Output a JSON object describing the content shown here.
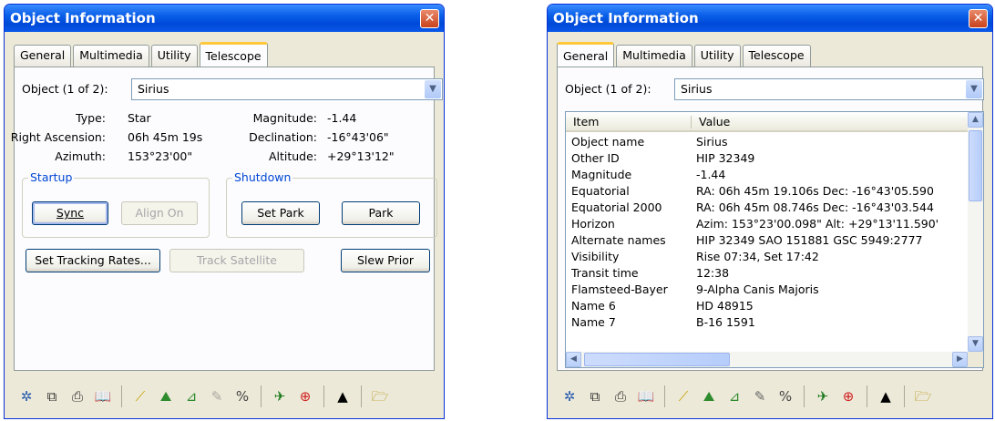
{
  "left_window": {
    "title": "Object Information",
    "close_glyph": "✕",
    "tabs": [
      {
        "label": "General"
      },
      {
        "label": "Multimedia"
      },
      {
        "label": "Utility"
      },
      {
        "label": "Telescope",
        "active": true
      }
    ],
    "object_label": "Object (1 of 2):",
    "object_value": "Sirius",
    "type_label": "Type:",
    "type_value": "Star",
    "ra_label": "Right Ascension:",
    "ra_value": "06h 45m 19s",
    "azimuth_label": "Azimuth:",
    "azimuth_value": "153°23'00\"",
    "magnitude_label": "Magnitude:",
    "magnitude_value": "-1.44",
    "declination_label": "Declination:",
    "declination_value": "-16°43'06\"",
    "altitude_label": "Altitude:",
    "altitude_value": "+29°13'12\"",
    "startup_title": "Startup",
    "shutdown_title": "Shutdown",
    "sync_label": "Sync",
    "align_on_label": "Align On",
    "set_park_label": "Set Park",
    "park_label": "Park",
    "set_tracking_rates_label": "Set Tracking Rates...",
    "track_satellite_label": "Track Satellite",
    "slew_prior_label": "Slew Prior"
  },
  "right_window": {
    "title": "Object Information",
    "close_glyph": "✕",
    "tabs": [
      {
        "label": "General",
        "active": true
      },
      {
        "label": "Multimedia"
      },
      {
        "label": "Utility"
      },
      {
        "label": "Telescope"
      }
    ],
    "object_label": "Object (1 of 2):",
    "object_value": "Sirius",
    "columns": [
      "Item",
      "Value"
    ],
    "rows": [
      {
        "item": "Object name",
        "value": "Sirius"
      },
      {
        "item": "Other ID",
        "value": "HIP 32349"
      },
      {
        "item": "Magnitude",
        "value": "-1.44"
      },
      {
        "item": "Equatorial",
        "value": "RA: 06h 45m 19.106s  Dec: -16°43'05.590"
      },
      {
        "item": "Equatorial 2000",
        "value": "RA: 06h 45m 08.746s  Dec: -16°43'03.544"
      },
      {
        "item": "Horizon",
        "value": "Azim: 153°23'00.098\"  Alt: +29°13'11.590'"
      },
      {
        "item": "Alternate names",
        "value": "HIP 32349 SAO 151881 GSC 5949:2777"
      },
      {
        "item": "Visibility",
        "value": "Rise 07:34, Set 17:42"
      },
      {
        "item": "Transit time",
        "value": "12:38"
      },
      {
        "item": "Flamsteed-Bayer",
        "value": "9-Alpha Canis Majoris"
      },
      {
        "item": "Name 6",
        "value": "HD 48915"
      },
      {
        "item": "Name 7",
        "value": "B-16 1591"
      }
    ]
  },
  "toolbar_icons": [
    {
      "name": "sparkle-icon",
      "glyph": "✲",
      "color": "#2a5db0"
    },
    {
      "name": "copy-icon",
      "glyph": "⧉",
      "color": "#333333"
    },
    {
      "name": "print-icon",
      "glyph": "⎙",
      "color": "#333333"
    },
    {
      "name": "book-icon",
      "glyph": "📖",
      "color": "#333333"
    },
    {
      "name": "ruler-icon",
      "glyph": "⟋",
      "color": "#c8a000"
    },
    {
      "name": "landscape-icon",
      "glyph": "⛰",
      "color": "#2e8b2e"
    },
    {
      "name": "horizon-icon",
      "glyph": "⊿",
      "color": "#2e8b2e"
    },
    {
      "name": "chart-icon",
      "glyph": "✎",
      "color": "#666666"
    },
    {
      "name": "numbers-icon",
      "glyph": "%",
      "color": "#444444"
    },
    {
      "name": "telescope-icon",
      "glyph": "✈",
      "color": "#1f7a1f"
    },
    {
      "name": "target-icon",
      "glyph": "⊕",
      "color": "#d02020"
    },
    {
      "name": "up-arrow-icon",
      "glyph": "▲",
      "color": "#000000"
    },
    {
      "name": "open-folder-icon",
      "glyph": "🗁",
      "color": "#b08a00"
    }
  ]
}
